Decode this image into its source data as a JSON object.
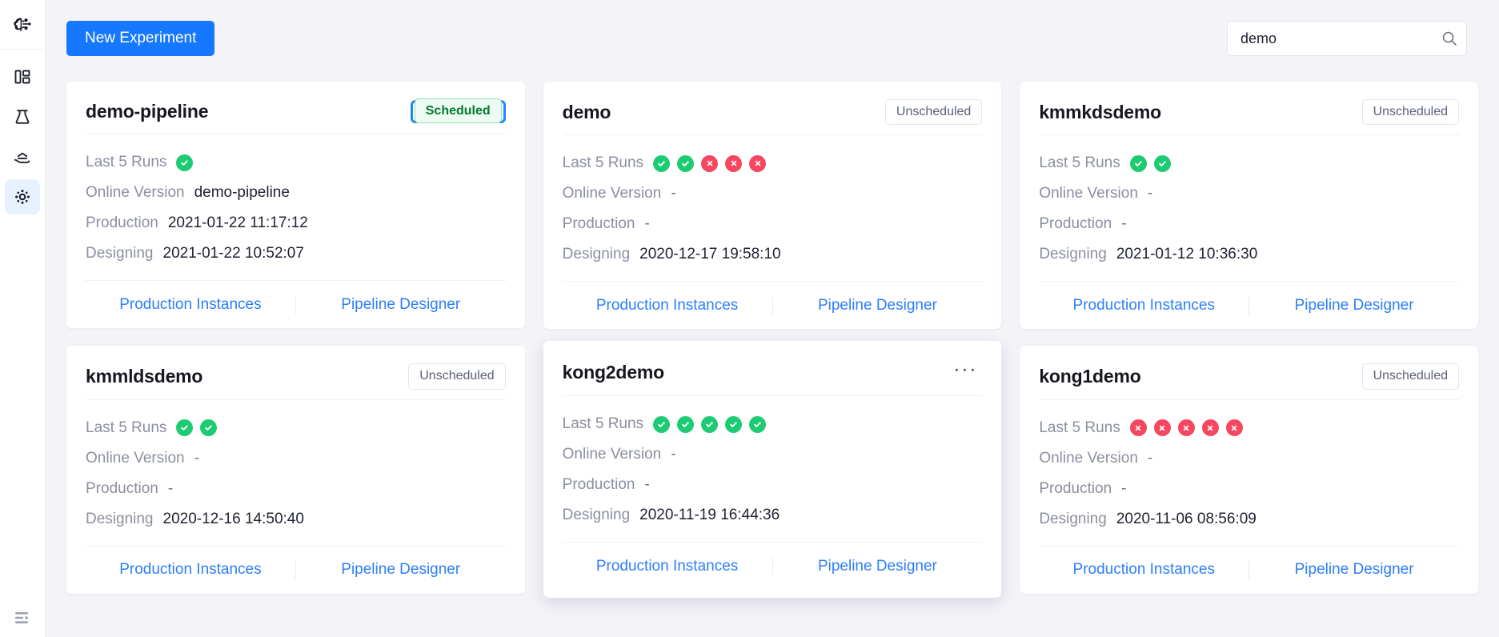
{
  "sidebar": {
    "logo": "brain-logo-icon",
    "items": [
      {
        "name": "dashboard",
        "icon": "dashboard-panels-icon",
        "active": false
      },
      {
        "name": "experiments",
        "icon": "flask-icon",
        "active": false
      },
      {
        "name": "serving",
        "icon": "serving-hand-icon",
        "active": false
      },
      {
        "name": "pipelines",
        "icon": "pipeline-target-icon",
        "active": true
      }
    ],
    "collapse": {
      "name": "expand-sidebar",
      "icon": "expand-sidebar-icon"
    }
  },
  "toolbar": {
    "new_experiment_label": "New Experiment",
    "search": {
      "value": "demo",
      "placeholder": "",
      "icon": "search-icon"
    }
  },
  "labels": {
    "last_runs": "Last 5 Runs",
    "online_version": "Online Version",
    "production": "Production",
    "designing": "Designing",
    "production_instances": "Production Instances",
    "pipeline_designer": "Pipeline Designer",
    "more_menu": "···"
  },
  "colors": {
    "accent": "#1677ff",
    "link": "#2c7efc",
    "success": "#1ccb72",
    "failure": "#f5475f",
    "scheduled_text": "#00792e",
    "scheduled_bg": "#edfbf2",
    "scheduled_border": "#8fe0ae",
    "focus_ring": "#1f85fb",
    "page_bg": "#f3f3f8"
  },
  "cards": [
    {
      "title": "demo-pipeline",
      "status": "Scheduled",
      "status_type": "scheduled",
      "focused": true,
      "hovered": false,
      "runs": [
        "success"
      ],
      "online_version": "demo-pipeline",
      "production": "2021-01-22 11:17:12",
      "designing": "2021-01-22 10:52:07"
    },
    {
      "title": "demo",
      "status": "Unscheduled",
      "status_type": "unscheduled",
      "focused": false,
      "hovered": false,
      "runs": [
        "success",
        "success",
        "failure",
        "failure",
        "failure"
      ],
      "online_version": "-",
      "production": "-",
      "designing": "2020-12-17 19:58:10"
    },
    {
      "title": "kmmkdsdemo",
      "status": "Unscheduled",
      "status_type": "unscheduled",
      "focused": false,
      "hovered": false,
      "runs": [
        "success",
        "success"
      ],
      "online_version": "-",
      "production": "-",
      "designing": "2021-01-12 10:36:30"
    },
    {
      "title": "kmmldsdemo",
      "status": "Unscheduled",
      "status_type": "unscheduled",
      "focused": false,
      "hovered": false,
      "runs": [
        "success",
        "success"
      ],
      "online_version": "-",
      "production": "-",
      "designing": "2020-12-16 14:50:40"
    },
    {
      "title": "kong2demo",
      "status": "",
      "status_type": "menu",
      "focused": false,
      "hovered": true,
      "runs": [
        "success",
        "success",
        "success",
        "success",
        "success"
      ],
      "online_version": "-",
      "production": "-",
      "designing": "2020-11-19 16:44:36"
    },
    {
      "title": "kong1demo",
      "status": "Unscheduled",
      "status_type": "unscheduled",
      "focused": false,
      "hovered": false,
      "runs": [
        "failure",
        "failure",
        "failure",
        "failure",
        "failure"
      ],
      "online_version": "-",
      "production": "-",
      "designing": "2020-11-06 08:56:09"
    }
  ]
}
